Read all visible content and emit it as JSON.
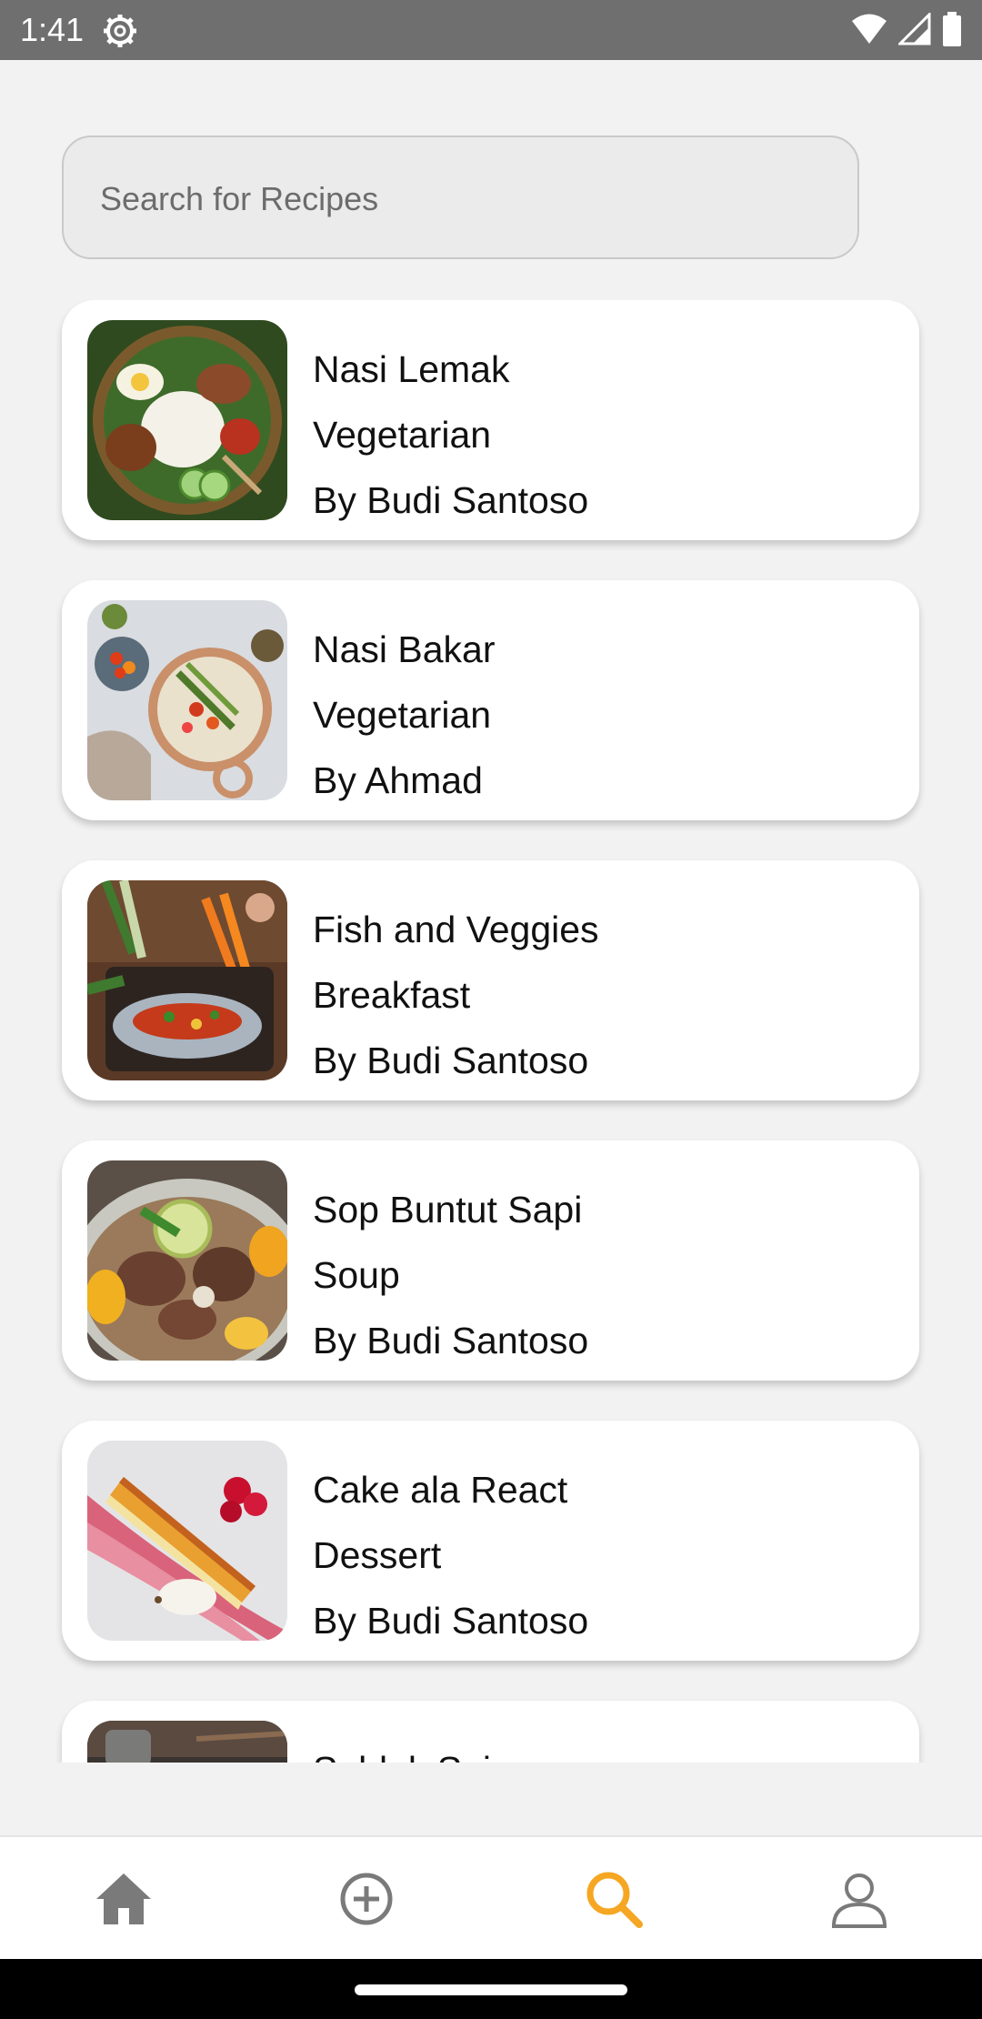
{
  "status_bar": {
    "time": "1:41",
    "icons": [
      "settings-gear-icon",
      "wifi-icon",
      "cellular-signal-icon",
      "battery-icon"
    ]
  },
  "search": {
    "placeholder": "Search for Recipes",
    "value": ""
  },
  "recipes": [
    {
      "title": "Nasi Lemak",
      "category": "Vegetarian",
      "author": "By Budi Santoso"
    },
    {
      "title": "Nasi Bakar",
      "category": "Vegetarian",
      "author": "By Ahmad"
    },
    {
      "title": "Fish and Veggies",
      "category": "Breakfast",
      "author": "By Budi Santoso"
    },
    {
      "title": "Sop Buntut Sapi",
      "category": "Soup",
      "author": "By Budi Santoso"
    },
    {
      "title": "Cake ala React",
      "category": "Dessert",
      "author": "By Budi Santoso"
    },
    {
      "title": "Seblak Spicy",
      "category": "",
      "author": ""
    }
  ],
  "bottom_nav": {
    "items": [
      {
        "name": "home",
        "icon": "home-icon",
        "active": false
      },
      {
        "name": "add",
        "icon": "add-circle-icon",
        "active": false
      },
      {
        "name": "search",
        "icon": "search-icon",
        "active": true
      },
      {
        "name": "profile",
        "icon": "profile-icon",
        "active": false
      }
    ],
    "active_color": "#F5A623",
    "inactive_color": "#7a7a7a"
  }
}
